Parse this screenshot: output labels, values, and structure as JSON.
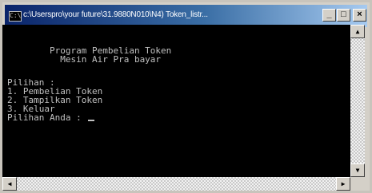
{
  "window": {
    "title": "c:\\Userspro\\your future\\31.9880N010\\N4) Token_listr..."
  },
  "title_buttons": {
    "minimize": "_",
    "maximize": "□",
    "close": "×"
  },
  "console": {
    "lines": [
      "        Program Pembelian Token",
      "          Mesin Air Pra bayar",
      "",
      "Pilihan :",
      "1. Pembelian Token",
      "2. Tampilkan Token",
      "3. Keluar",
      "Pilihan Anda : "
    ]
  },
  "scrollbars": {
    "up_arrow": "▲",
    "down_arrow": "▼",
    "left_arrow": "◀",
    "right_arrow": "▶"
  },
  "icons": {
    "window_icon": "console-icon"
  }
}
